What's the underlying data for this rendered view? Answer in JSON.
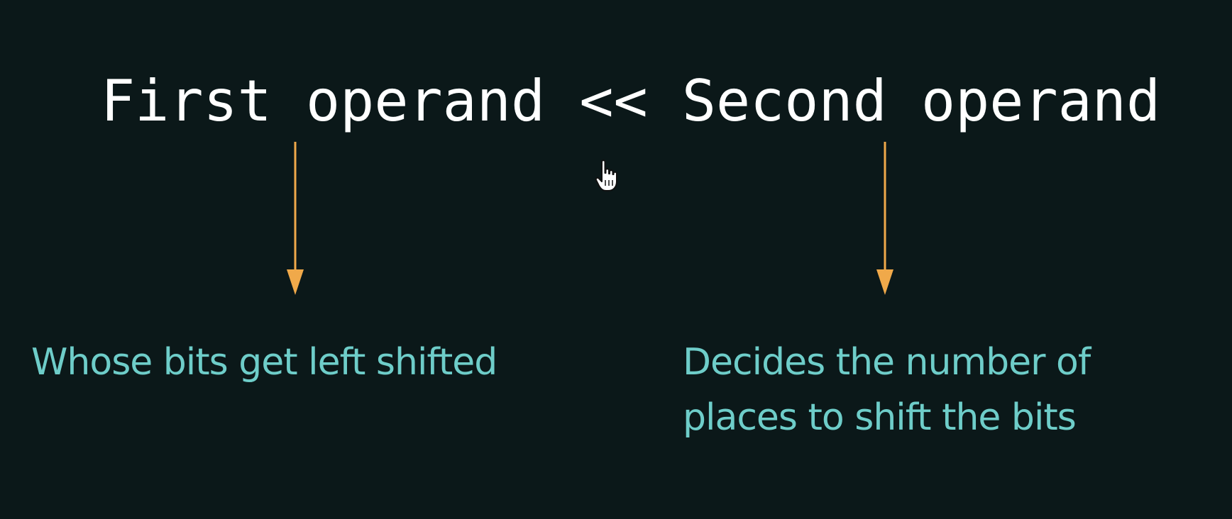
{
  "expression": {
    "first_operand": "First operand",
    "operator": "<<",
    "second_operand": "Second operand"
  },
  "descriptions": {
    "left": "Whose bits get left shifted",
    "right_line1": "Decides the number of",
    "right_line2": "places to shift the bits"
  },
  "colors": {
    "background": "#0b1819",
    "expression_text": "#ffffff",
    "arrow": "#f0a94a",
    "description_text": "#6ecdc9"
  },
  "icons": {
    "cursor": "hand-pointer-cursor-icon",
    "arrows": "down-arrow-icon"
  }
}
